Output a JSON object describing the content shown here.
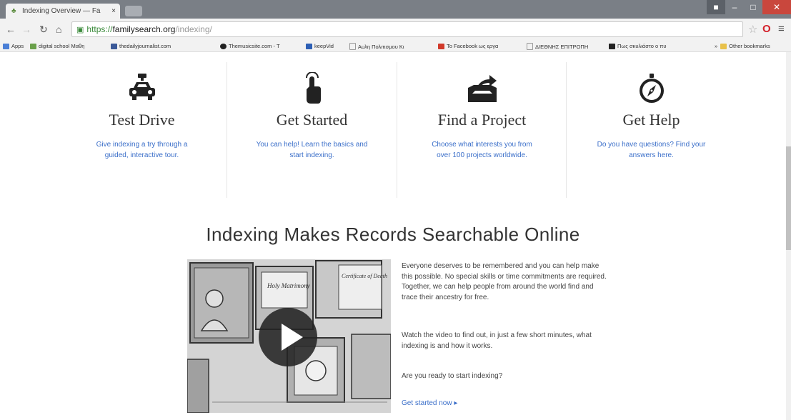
{
  "browser": {
    "tab_title": "Indexing Overview — Fa",
    "tab_close": "×",
    "url_scheme": "https://",
    "url_host": "familysearch.org",
    "url_path": "/indexing/",
    "bookmarks": [
      {
        "label": "Apps",
        "color": "#4a7fd6"
      },
      {
        "label": "digital school Μαθη",
        "color": "#6aa04a"
      },
      {
        "label": "thedailyjournalist.com",
        "color": "#3b5998"
      },
      {
        "label": "Themusicsite.com - T",
        "color": "#222222"
      },
      {
        "label": "keepVid",
        "color": "#2d5fb5"
      },
      {
        "label": "Αυλη Πολιτισμου Κι",
        "color": "#999999"
      },
      {
        "label": "Το Facebook ως εργα",
        "color": "#d13a2a"
      },
      {
        "label": "ΔΙΕΘΝΗΣ ΕΠΙΤΡΟΠΗ",
        "color": "#999999"
      },
      {
        "label": "Πως σκυλιάστο ο πυ",
        "color": "#222222"
      }
    ],
    "other_bookmarks": "Other bookmarks"
  },
  "features": [
    {
      "title": "Test Drive",
      "desc": "Give indexing a try through a guided, interactive tour.",
      "icon": "car-icon"
    },
    {
      "title": "Get Started",
      "desc": "You can help! Learn the basics and start indexing.",
      "icon": "pointer-hand-icon"
    },
    {
      "title": "Find a Project",
      "desc": "Choose what interests you from over 100 projects worldwide.",
      "icon": "open-box-arrow-icon"
    },
    {
      "title": "Get Help",
      "desc": "Do you have questions? Find your answers here.",
      "icon": "compass-icon"
    }
  ],
  "section": {
    "title": "Indexing Makes Records Searchable Online",
    "paragraphs": [
      "Everyone deserves to be remembered and you can help make this possible. No special skills or time commitments are required. Together, we can help people from around the world find and trace their ancestry for free.",
      "Watch the video to find out, in just a few short minutes, what indexing is and how it works.",
      "Are you ready to start indexing?"
    ],
    "cta": "Get started now ▸",
    "video_labels": [
      "Holy Matrimony",
      "Certificate of Death"
    ]
  },
  "colors": {
    "link": "#3b6fc9",
    "heading": "#333333"
  }
}
